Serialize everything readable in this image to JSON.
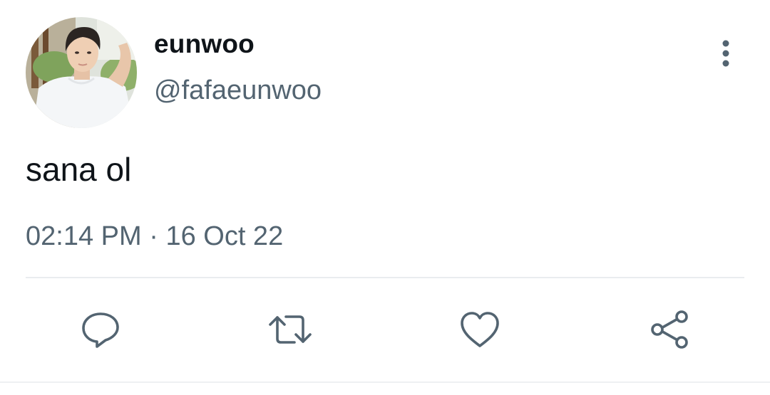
{
  "tweet": {
    "display_name": "eunwoo",
    "handle": "@fafaeunwoo",
    "text": "sana ol",
    "time": "02:14 PM",
    "separator": "·",
    "date": "16 Oct 22"
  },
  "icons": {
    "more": "more-vertical-icon",
    "reply": "reply-icon",
    "retweet": "retweet-icon",
    "like": "heart-icon",
    "share": "share-icon"
  },
  "colors": {
    "primary_text": "#0f1419",
    "secondary_text": "#536471",
    "icon": "#536471",
    "divider": "#e9ecef"
  }
}
